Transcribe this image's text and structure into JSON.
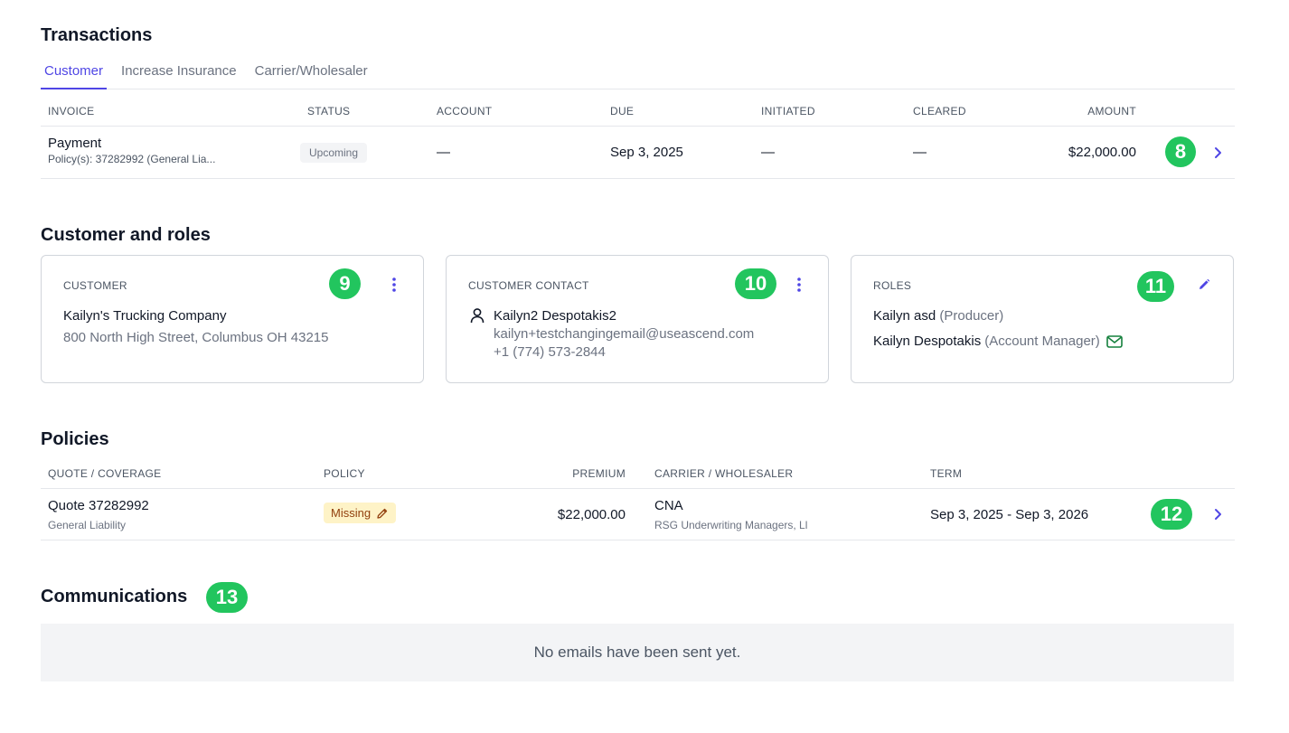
{
  "transactions": {
    "title": "Transactions",
    "tabs": [
      {
        "label": "Customer",
        "active": true
      },
      {
        "label": "Increase Insurance",
        "active": false
      },
      {
        "label": "Carrier/Wholesaler",
        "active": false
      }
    ],
    "columns": {
      "invoice": "INVOICE",
      "status": "STATUS",
      "account": "ACCOUNT",
      "due": "DUE",
      "initiated": "INITIATED",
      "cleared": "CLEARED",
      "amount": "AMOUNT"
    },
    "rows": [
      {
        "invoice": "Payment",
        "invoice_sub": "Policy(s): 37282992 (General Lia...",
        "status": "Upcoming",
        "account": "—",
        "due": "Sep 3, 2025",
        "initiated": "—",
        "cleared": "—",
        "amount": "$22,000.00",
        "marker": "8"
      }
    ]
  },
  "customer_roles": {
    "title": "Customer and roles",
    "customer_card": {
      "label": "CUSTOMER",
      "marker": "9",
      "name": "Kailyn's Trucking Company",
      "address": "800 North High Street, Columbus OH 43215"
    },
    "contact_card": {
      "label": "CUSTOMER CONTACT",
      "marker": "10",
      "name": "Kailyn2 Despotakis2",
      "email": "kailyn+testchangingemail@useascend.com",
      "phone": "+1 (774) 573-2844"
    },
    "roles_card": {
      "label": "ROLES",
      "marker": "11",
      "roles": [
        {
          "name": "Kailyn asd",
          "role": "(Producer)"
        },
        {
          "name": "Kailyn Despotakis",
          "role": "(Account Manager)"
        }
      ]
    }
  },
  "policies": {
    "title": "Policies",
    "columns": {
      "quote": "QUOTE / COVERAGE",
      "policy": "POLICY",
      "premium": "PREMIUM",
      "carrier": "CARRIER / WHOLESALER",
      "term": "TERM"
    },
    "rows": [
      {
        "quote": "Quote 37282992",
        "coverage": "General Liability",
        "policy_status": "Missing",
        "premium": "$22,000.00",
        "carrier": "CNA",
        "wholesaler": "RSG Underwriting Managers, Ll",
        "term": "Sep 3, 2025 - Sep 3, 2026",
        "marker": "12"
      }
    ]
  },
  "communications": {
    "title": "Communications",
    "marker": "13",
    "empty_text": "No emails have been sent yet."
  },
  "colors": {
    "accent": "#4f46e5",
    "marker_green": "#22c55e",
    "mail_green": "#15803d"
  }
}
